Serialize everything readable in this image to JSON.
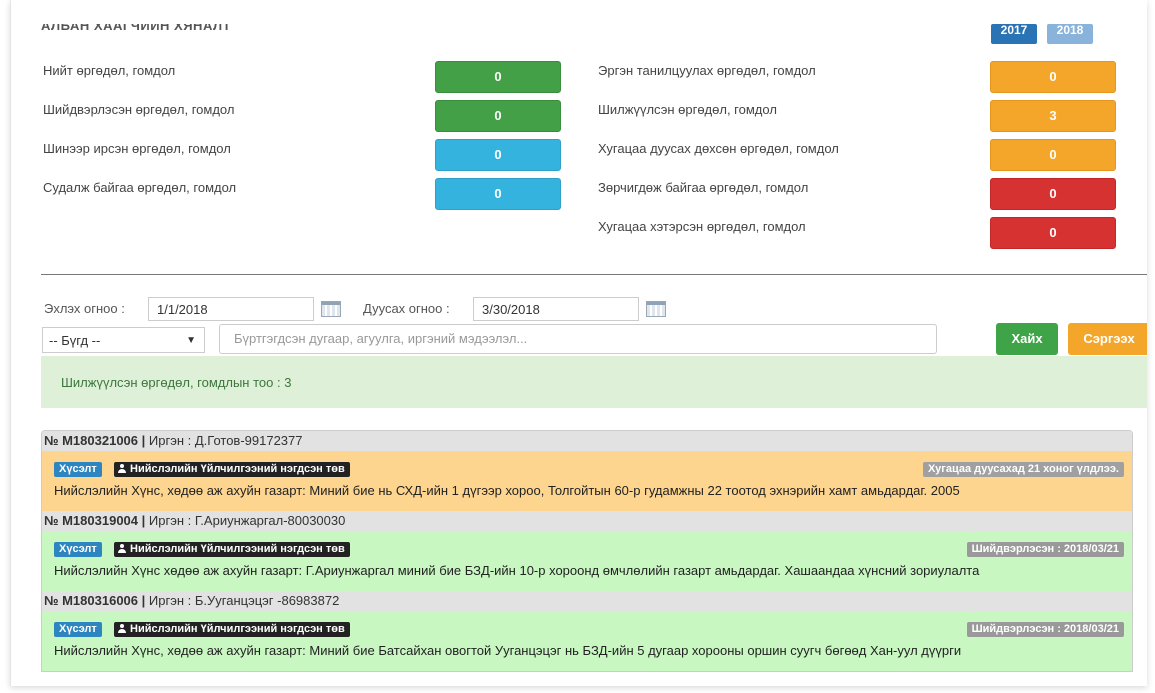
{
  "header": {
    "title_partial": "АЛБАН ХААГЧИЙН ХЯНАЛТ",
    "years": [
      {
        "label": "2017",
        "color": "#2a73b5"
      },
      {
        "label": "2018",
        "color": "#8ab3dc"
      }
    ]
  },
  "stats_left": [
    {
      "label": "Нийт өргөдөл, гомдол",
      "value": "0",
      "color": "green"
    },
    {
      "label": "Шийдвэрлэсэн өргөдөл, гомдол",
      "value": "0",
      "color": "green"
    },
    {
      "label": "Шинээр ирсэн өргөдөл, гомдол",
      "value": "0",
      "color": "blue"
    },
    {
      "label": "Судалж байгаа өргөдөл, гомдол",
      "value": "0",
      "color": "blue"
    }
  ],
  "stats_right": [
    {
      "label": "Эргэн танилцуулах өргөдөл, гомдол",
      "value": "0",
      "color": "orange"
    },
    {
      "label": "Шилжүүлсэн өргөдөл, гомдол",
      "value": "3",
      "color": "orange"
    },
    {
      "label": "Хугацаа дуусах дөхсөн өргөдөл, гомдол",
      "value": "0",
      "color": "orange"
    },
    {
      "label": "Зөрчигдөж байгаа өргөдөл, гомдол",
      "value": "0",
      "color": "red"
    },
    {
      "label": "Хугацаа хэтэрсэн өргөдөл, гомдол",
      "value": "0",
      "color": "red"
    }
  ],
  "filter": {
    "start_label": "Эхлэх огноо :",
    "start_value": "1/1/2018",
    "end_label": "Дуусах огноо :",
    "end_value": "3/30/2018",
    "select_value": "-- Бүгд --",
    "search_placeholder": "Бүртгэгдсэн дугаар, агуулга, иргэний мэдээлэл...",
    "search_button": "Хайх",
    "reset_button": "Сэргээх"
  },
  "info": {
    "text": "Шилжүүлсэн өргөдөл, гомдлын тоо : 3"
  },
  "items": [
    {
      "number": "№ М180321006 |",
      "citizen": "Иргэн : Д.Готов-99172377",
      "type": "Хүсэлт",
      "org": "Нийслэлийн Үйлчилгээний нэгдсэн төв",
      "status": "Хугацаа дуусахад 21 хоног үлдлээ.",
      "status_color": "#a0a0a0",
      "variant": "warn",
      "text": "Нийслэлийн Хүнс, хөдөө аж ахуйн газарт: Миний бие нь СХД-ийн 1 дүгээр хороо, Толгойтын 60-р гудамжны 22 тоотод эхнэрийн хамт амьдардаг. 2005"
    },
    {
      "number": "№ М180319004 |",
      "citizen": "Иргэн : Г.Ариунжаргал-80030030",
      "type": "Хүсэлт",
      "org": "Нийслэлийн Үйлчилгээний нэгдсэн төв",
      "status": "Шийдвэрлэсэн : 2018/03/21",
      "status_color": "#999999",
      "variant": "ok",
      "text": "Нийслэлийн Хүнс хөдөө аж ахуйн газарт: Г.Ариунжаргал миний бие БЗД-ийн 10-р хороонд өмчлөлийн газарт амьдардаг. Хашаандаа хүнсний зориулалта"
    },
    {
      "number": "№ М180316006 |",
      "citizen": "Иргэн : Б.Ууганцэцэг -86983872",
      "type": "Хүсэлт",
      "org": "Нийслэлийн Үйлчилгээний нэгдсэн төв",
      "status": "Шийдвэрлэсэн : 2018/03/21",
      "status_color": "#999999",
      "variant": "ok",
      "text": "Нийслэлийн Хүнс, хөдөө аж ахуйн газарт: Миний бие Батсайхан овогтой Ууганцэцэг нь БЗД-ийн 5 дугаар хорооны оршин суугч бөгөөд Хан-уул дүүрги"
    }
  ]
}
